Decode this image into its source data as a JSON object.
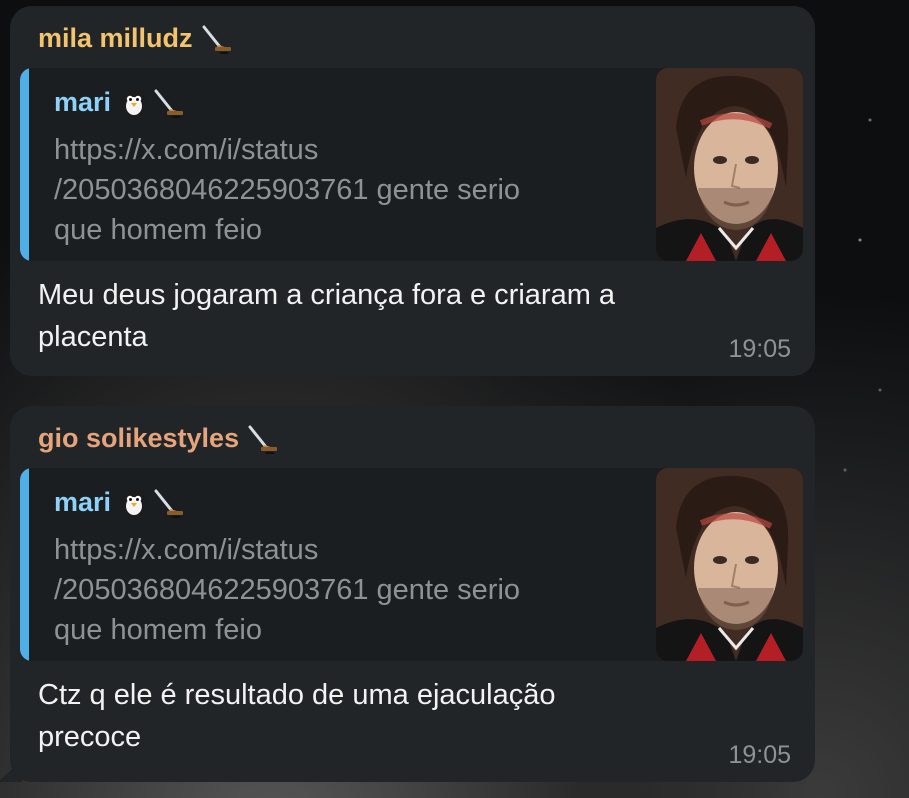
{
  "messages": [
    {
      "sender": "mila milludz",
      "sender_emoji": "hockey-stick-icon",
      "reply": {
        "author": "mari",
        "author_emojis": [
          "penguin-icon",
          "hockey-stick-icon"
        ],
        "lines": [
          "https://x.com/i/status",
          "/2050368046225903761 gente serio",
          "que homem feio"
        ],
        "thumbnail": "man-photo-thumbnail"
      },
      "text_lines": [
        "Meu deus jogaram a criança fora e criaram a",
        "placenta"
      ],
      "time": "19:05"
    },
    {
      "sender": "gio solikestyles",
      "sender_emoji": "hockey-stick-icon",
      "reply": {
        "author": "mari",
        "author_emojis": [
          "penguin-icon",
          "hockey-stick-icon"
        ],
        "lines": [
          "https://x.com/i/status",
          "/2050368046225903761 gente serio",
          "que homem feio"
        ],
        "thumbnail": "man-photo-thumbnail"
      },
      "text_lines": [
        "Ctz q ele é resultado de uma ejaculação",
        "precoce"
      ],
      "time": "19:05"
    }
  ],
  "colors": {
    "bubble": "#212528",
    "quote_bg": "#1a1e21",
    "quote_bar": "#4fb0e8",
    "sender_1": "#f3c36e",
    "sender_2": "#e5a47b",
    "reply_author": "#8fd2f7",
    "secondary_text": "#8c9296"
  }
}
